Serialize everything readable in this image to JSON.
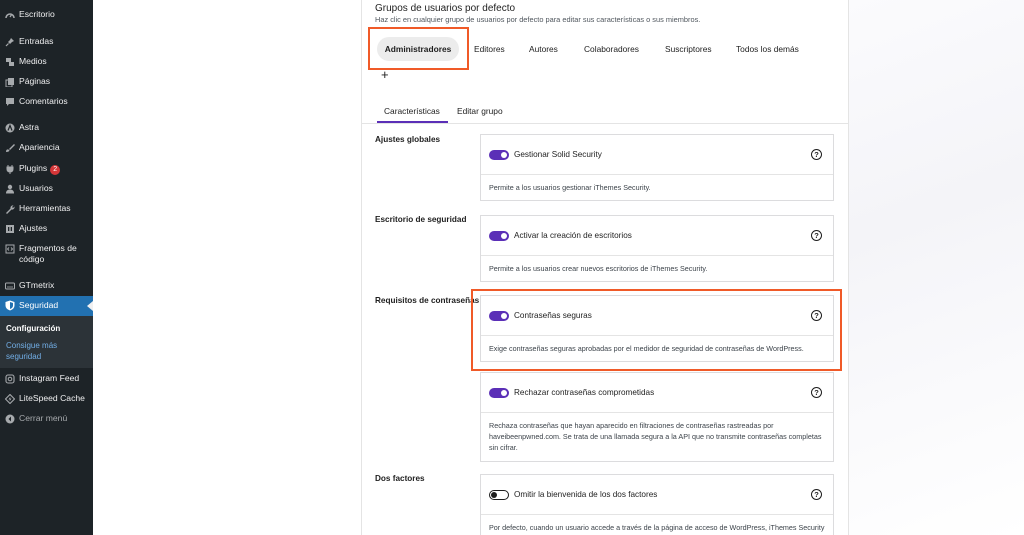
{
  "sidebar": {
    "items": [
      {
        "label": "Escritorio",
        "icon": "dashboard-icon"
      },
      {
        "label": "Entradas",
        "icon": "pin-icon"
      },
      {
        "label": "Medios",
        "icon": "media-icon"
      },
      {
        "label": "Páginas",
        "icon": "pages-icon"
      },
      {
        "label": "Comentarios",
        "icon": "comments-icon"
      },
      {
        "label": "Astra",
        "icon": "astra-icon"
      },
      {
        "label": "Apariencia",
        "icon": "brush-icon"
      },
      {
        "label": "Plugins",
        "icon": "plugin-icon",
        "badge": "2"
      },
      {
        "label": "Usuarios",
        "icon": "users-icon"
      },
      {
        "label": "Herramientas",
        "icon": "wrench-icon"
      },
      {
        "label": "Ajustes",
        "icon": "settings-icon"
      },
      {
        "label": "Fragmentos de código",
        "icon": "code-icon"
      },
      {
        "label": "GTmetrix",
        "icon": "gtmetrix-icon"
      },
      {
        "label": "Seguridad",
        "icon": "shield-icon"
      },
      {
        "label": "Instagram Feed",
        "icon": "instagram-icon"
      },
      {
        "label": "LiteSpeed Cache",
        "icon": "litespeed-icon"
      },
      {
        "label": "Cerrar menú",
        "icon": "collapse-icon"
      }
    ],
    "submenu": {
      "current": "Configuración",
      "link": "Consigue más seguridad"
    }
  },
  "header": {
    "title": "Grupos de usuarios por defecto",
    "subtitle": "Haz clic en cualquier grupo de usuarios por defecto para editar sus características o sus miembros."
  },
  "groups": {
    "tabs": [
      "Administradores",
      "Editores",
      "Autores",
      "Colaboradores",
      "Suscriptores",
      "Todos los demás"
    ],
    "add_label": "+"
  },
  "subtabs": [
    "Características",
    "Editar grupo"
  ],
  "sections": {
    "global": "Ajustes globales",
    "dashboard": "Escritorio de seguridad",
    "passwords": "Requisitos de contraseñas",
    "two_factor": "Dos factores"
  },
  "cards": [
    {
      "title": "Gestionar Solid Security",
      "enabled": true,
      "desc": "Permite a los usuarios gestionar iThemes Security."
    },
    {
      "title": "Activar la creación de escritorios",
      "enabled": true,
      "desc": "Permite a los usuarios crear nuevos escritorios de iThemes Security."
    },
    {
      "title": "Contraseñas seguras",
      "enabled": true,
      "desc": "Exige contraseñas seguras aprobadas por el medidor de seguridad de contraseñas de WordPress."
    },
    {
      "title": "Rechazar contraseñas comprometidas",
      "enabled": true,
      "desc": "Rechaza contraseñas que hayan aparecido en filtraciones de contraseñas rastreadas por haveibeenpwned.com. Se trata de una llamada segura a la API que no transmite contraseñas completas sin cifrar."
    },
    {
      "title": "Omitir la bienvenida de los dos factores",
      "enabled": false,
      "desc": "Por defecto, cuando un usuario accede a través de la página de acceso de WordPress, iThemes Security"
    }
  ],
  "colors": {
    "accent": "#5b2fb7",
    "highlight": "#f05a28",
    "sidebar": "#1d2327",
    "sidebar_active": "#2271b1"
  }
}
